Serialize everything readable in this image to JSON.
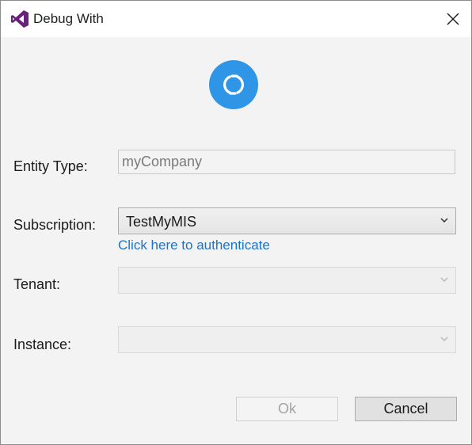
{
  "window": {
    "title": "Debug With"
  },
  "colors": {
    "accent": "#2f95e7",
    "link": "#1e73c9",
    "vs_purple": "#68217a"
  },
  "icons": {
    "title": "visual-studio-icon",
    "logo": "dynamics-logo-icon",
    "close": "close-icon",
    "dropdown": "chevron-down-icon"
  },
  "form": {
    "entity_type": {
      "label": "Entity Type:",
      "value": "myCompany"
    },
    "subscription": {
      "label": "Subscription:",
      "selected": "TestMyMIS",
      "auth_link": "Click here to authenticate"
    },
    "tenant": {
      "label": "Tenant:",
      "selected": ""
    },
    "instance": {
      "label": "Instance:",
      "selected": ""
    }
  },
  "buttons": {
    "ok": "Ok",
    "cancel": "Cancel"
  }
}
